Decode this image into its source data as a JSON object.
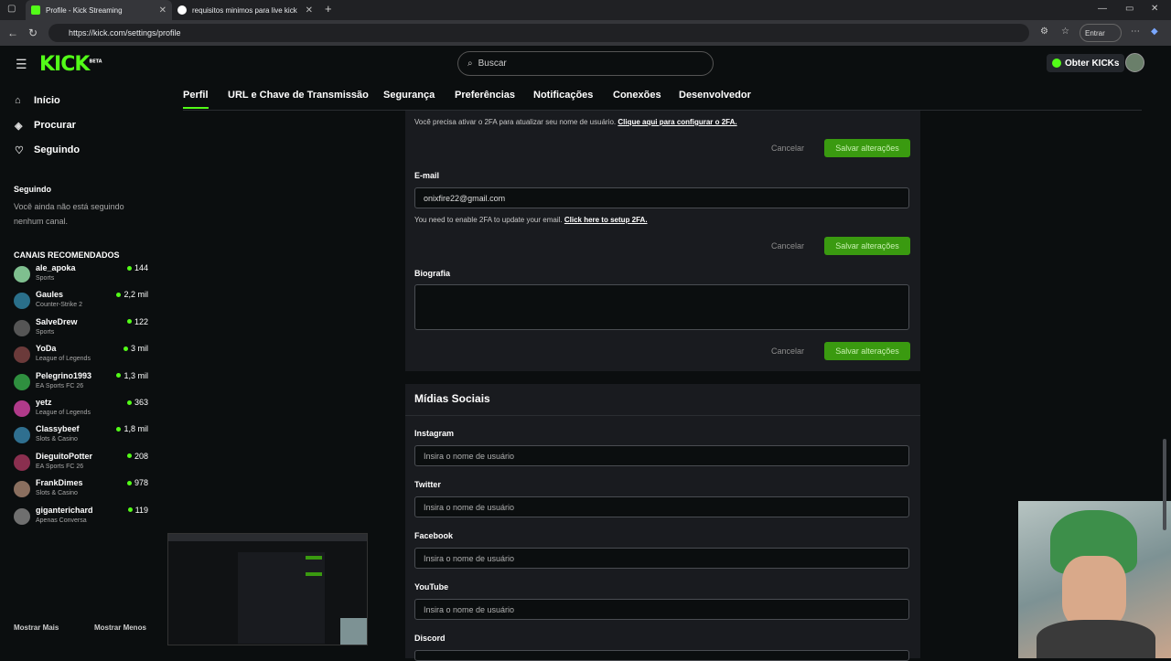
{
  "browser": {
    "tabs": [
      {
        "title": "Profile - Kick Streaming"
      },
      {
        "title": "requisitos minimos para live kick"
      }
    ],
    "url": "https://kick.com/settings/profile",
    "signin_label": "Entrar"
  },
  "header": {
    "logo": "KICK",
    "logo_badge": "BETA",
    "search_placeholder": "Buscar",
    "get_kicks_label": "Obter KICKs"
  },
  "sidebar": {
    "nav": [
      {
        "label": "Início",
        "icon": "home-icon"
      },
      {
        "label": "Procurar",
        "icon": "compass-icon"
      },
      {
        "label": "Seguindo",
        "icon": "heart-icon"
      }
    ],
    "following_title": "Seguindo",
    "following_empty": "Você ainda não está seguindo nenhum canal.",
    "recommended_title": "CANAIS RECOMENDADOS",
    "channels": [
      {
        "name": "ale_apoka",
        "category": "Sports",
        "viewers": "144",
        "color": "#7fbf8f"
      },
      {
        "name": "Gaules",
        "category": "Counter-Strike 2",
        "viewers": "2,2 mil",
        "color": "#2a6f8a"
      },
      {
        "name": "SalveDrew",
        "category": "Sports",
        "viewers": "122",
        "color": "#555555"
      },
      {
        "name": "YoDa",
        "category": "League of Legends",
        "viewers": "3 mil",
        "color": "#6b3a3a"
      },
      {
        "name": "Pelegrino1993",
        "category": "EA Sports FC 26",
        "viewers": "1,3 mil",
        "color": "#2f8f3f"
      },
      {
        "name": "yetz",
        "category": "League of Legends",
        "viewers": "363",
        "color": "#b03a8a"
      },
      {
        "name": "Classybeef",
        "category": "Slots & Casino",
        "viewers": "1,8 mil",
        "color": "#2f6f8f"
      },
      {
        "name": "DieguitoPotter",
        "category": "EA Sports FC 26",
        "viewers": "208",
        "color": "#8a2f4f"
      },
      {
        "name": "FrankDimes",
        "category": "Slots & Casino",
        "viewers": "978",
        "color": "#8a6f5f"
      },
      {
        "name": "giganterichard",
        "category": "Apenas Conversa",
        "viewers": "119",
        "color": "#6f6f6f"
      }
    ],
    "show_more": "Mostrar Mais",
    "show_less": "Mostrar Menos"
  },
  "settings_tabs": [
    "Perfil",
    "URL e Chave de Transmissão",
    "Segurança",
    "Preferências",
    "Notificações",
    "Conexões",
    "Desenvolvedor"
  ],
  "profile": {
    "username_hint": "Você precisa ativar o 2FA para atualizar seu nome de usuário.",
    "username_link": "Clique aqui para configurar o 2FA.",
    "cancel_label": "Cancelar",
    "save_label": "Salvar alterações",
    "email_label": "E-mail",
    "email_value": "onixfire22@gmail.com",
    "email_hint": "You need to enable 2FA to update your email.",
    "email_link": "Click here to setup 2FA.",
    "bio_label": "Biografia"
  },
  "social": {
    "title": "Mídias Sociais",
    "placeholder": "Insira o nome de usuário",
    "fields": [
      "Instagram",
      "Twitter",
      "Facebook",
      "YouTube",
      "Discord"
    ]
  },
  "colors": {
    "accent": "#53fc18",
    "button": "#3a9a10"
  }
}
